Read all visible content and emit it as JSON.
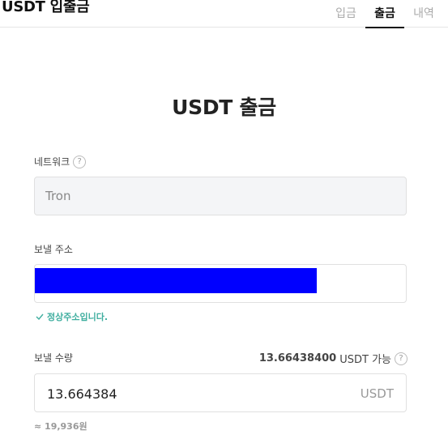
{
  "app": {
    "title": "USDT 입출금"
  },
  "tabs": [
    {
      "label": "입금",
      "active": false
    },
    {
      "label": "출금",
      "active": true
    },
    {
      "label": "내역",
      "active": false
    }
  ],
  "main": {
    "title": "USDT 출금",
    "network": {
      "label": "네트워크",
      "value": "Tron"
    },
    "address": {
      "label": "보낼 주소",
      "validation": "정상주소입니다."
    },
    "amount": {
      "label": "보낼 수량",
      "available_value": "13.66438400",
      "available_suffix": "USDT 가능",
      "value": "13.664384",
      "unit": "USDT",
      "krw_estimate": "≈ 19,936원"
    }
  },
  "colors": {
    "redaction": "#0000ff",
    "valid": "#3fae9f",
    "active_tab": "#111111",
    "inactive_tab": "#aaaaaa"
  },
  "icons": {
    "help": "question-circle-icon",
    "check": "check-icon"
  }
}
